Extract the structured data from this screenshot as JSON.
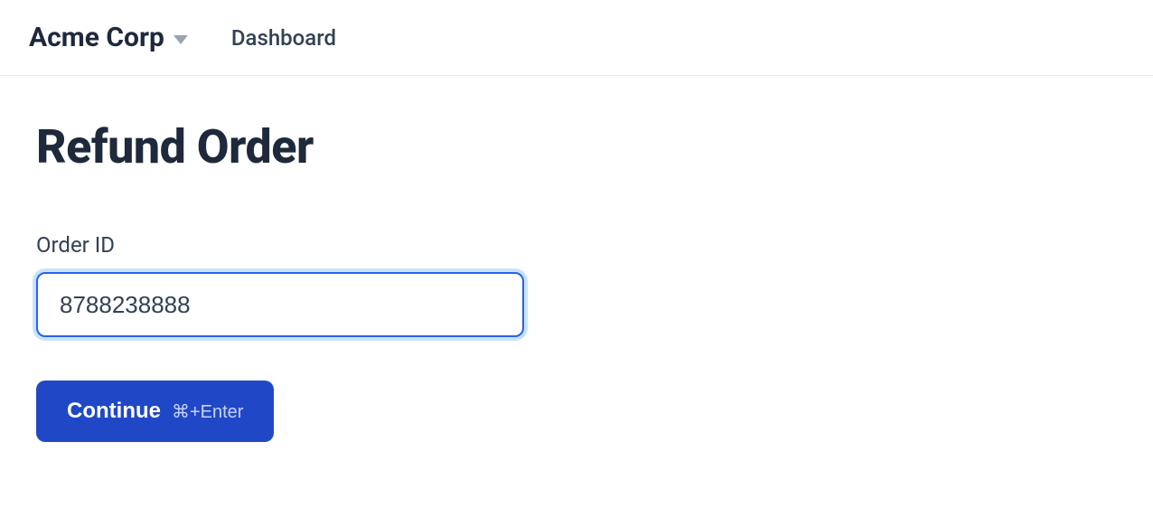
{
  "header": {
    "org_name": "Acme Corp",
    "nav": {
      "dashboard_label": "Dashboard"
    }
  },
  "page": {
    "title": "Refund Order"
  },
  "form": {
    "order_id_label": "Order ID",
    "order_id_value": "8788238888"
  },
  "actions": {
    "continue_label": "Continue",
    "continue_shortcut": "⌘+Enter"
  }
}
